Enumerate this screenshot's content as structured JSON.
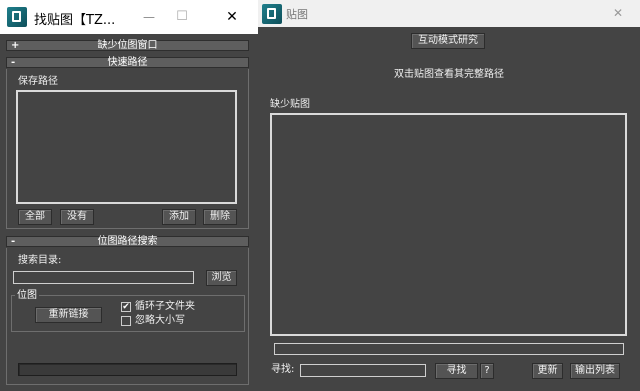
{
  "left_window": {
    "title": "找贴图【TZ...",
    "controls": {
      "minimize": "—",
      "maximize": "☐",
      "close": "✕"
    },
    "rollout_missing": {
      "sign": "+",
      "title": "缺少位图窗口"
    },
    "rollout_fast": {
      "sign": "-",
      "title": "快速路径",
      "list_caption": "保存路径",
      "buttons": {
        "all": "全部",
        "none": "没有",
        "add": "添加",
        "delete": "删除"
      }
    },
    "rollout_search": {
      "sign": "-",
      "title": "位图路径搜索",
      "dir_label": "搜索目录:",
      "dir_value": "",
      "browse": "浏览",
      "bitmap_group": "位图",
      "relink": "重新链接",
      "loop_subfolders": {
        "label": "循环子文件夹",
        "checked": true,
        "mark": "✔"
      },
      "ignore_case": {
        "label": "忽略大小写",
        "checked": false
      }
    }
  },
  "right_window": {
    "title": "贴图",
    "controls": {
      "close": "✕"
    },
    "interactive_mode": "互动模式研究",
    "hint": "双击贴图查看其完整路径",
    "missing_caption": "缺少贴图",
    "find_label": "寻找:",
    "find_value": "",
    "find_button": "寻找",
    "help_button": "?",
    "update_button": "更新",
    "export_button": "输出列表"
  }
}
